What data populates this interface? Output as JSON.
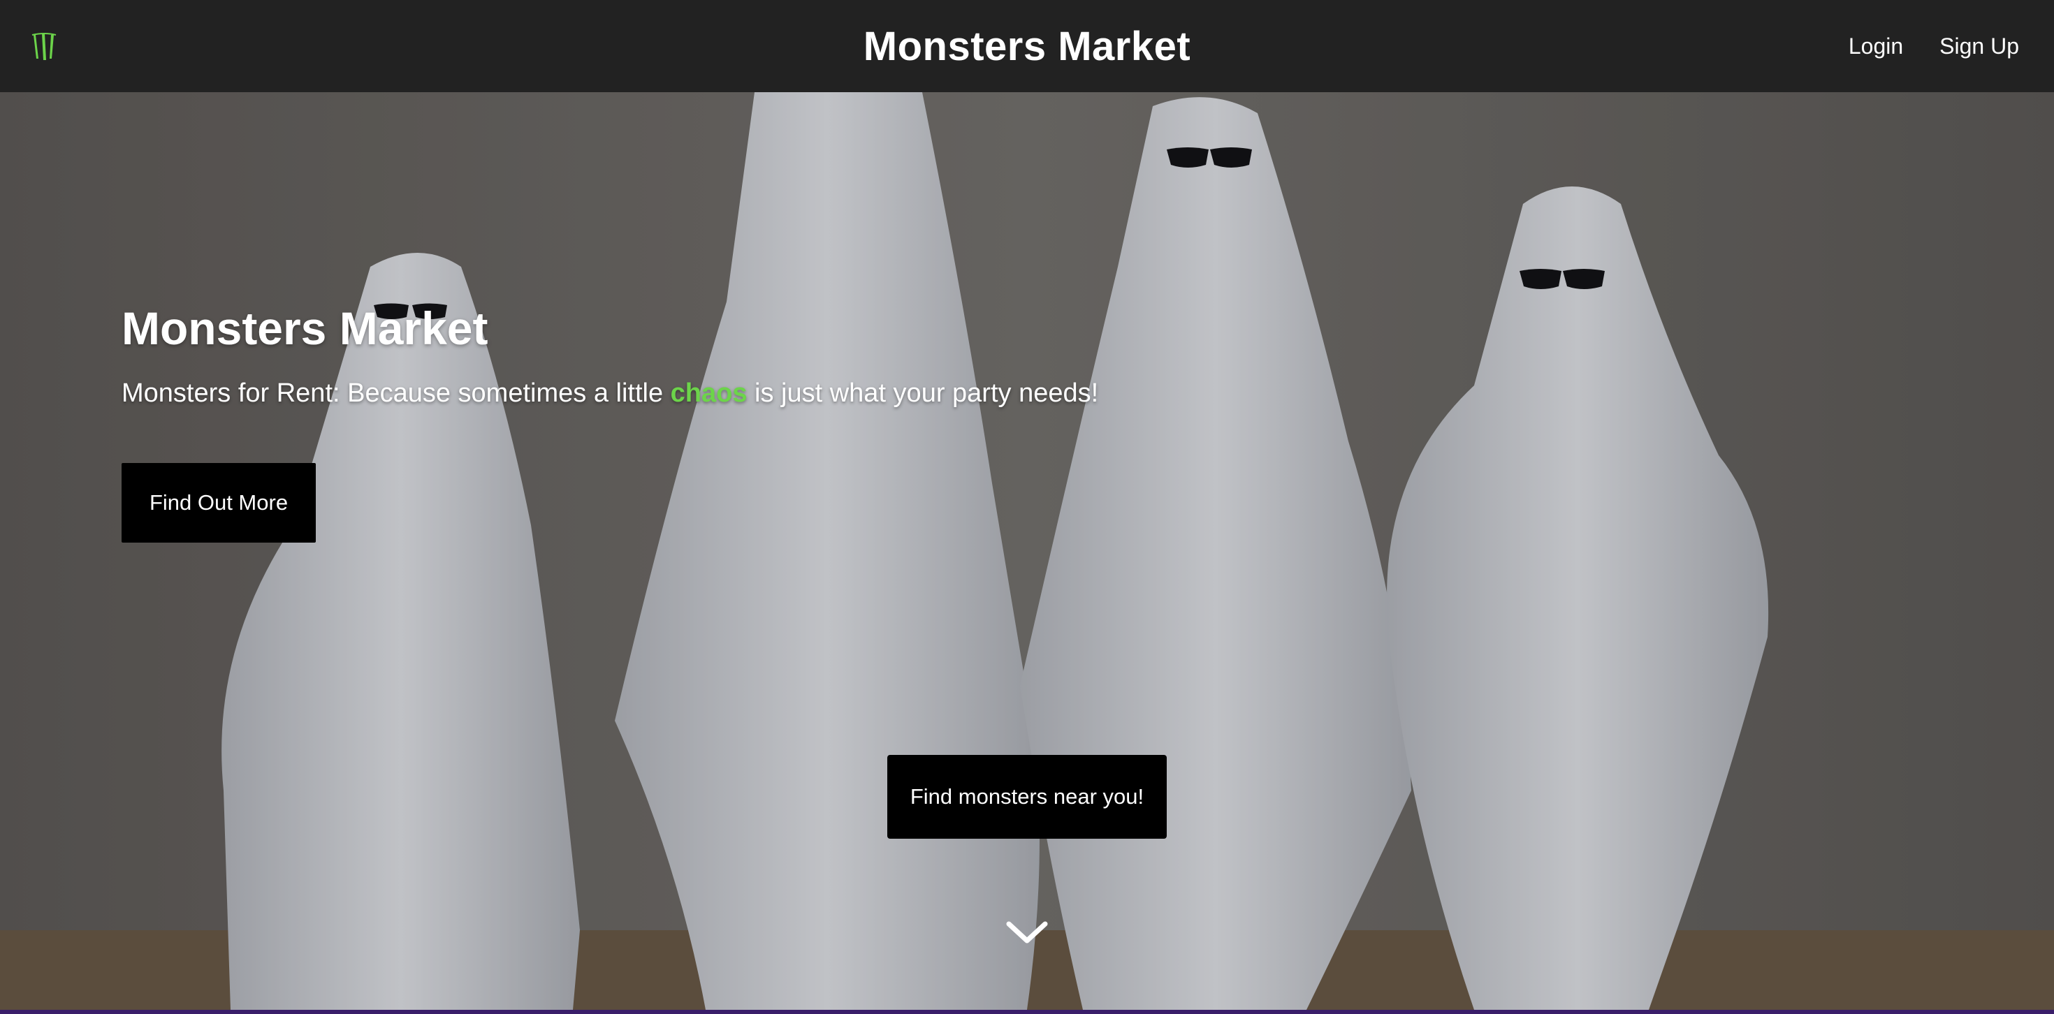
{
  "navbar": {
    "logo_icon": "monster-claw-logo",
    "brand": "Monsters Market",
    "links": [
      {
        "label": "Login"
      },
      {
        "label": "Sign Up"
      }
    ]
  },
  "hero": {
    "title": "Monsters Market",
    "subtitle_before": "Monsters for Rent: Because sometimes a little ",
    "subtitle_accent": "chaos",
    "subtitle_after": " is just what your party needs!",
    "cta_label": "Find Out More",
    "near_label": "Find monsters near you!",
    "scroll_icon": "chevron-down-icon"
  },
  "colors": {
    "nav_bg": "#222222",
    "accent_green": "#6cd44a",
    "button_bg": "#000000"
  }
}
